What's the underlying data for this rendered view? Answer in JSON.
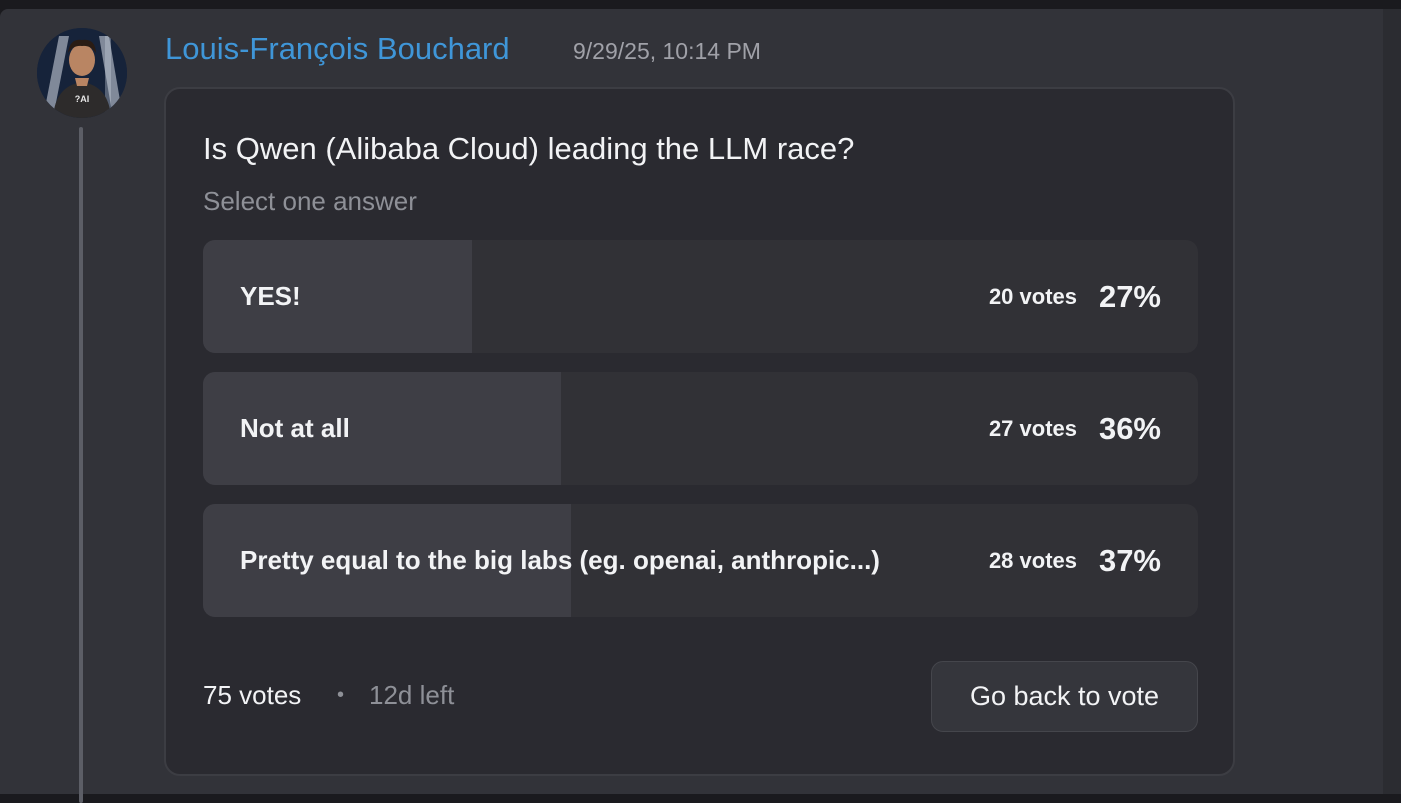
{
  "message": {
    "author": "Louis-François Bouchard",
    "timestamp": "9/29/25, 10:14 PM",
    "avatar_text": "?AI"
  },
  "poll": {
    "question": "Is Qwen (Alibaba Cloud) leading the LLM race?",
    "instruction": "Select one answer",
    "answers": [
      {
        "label": "YES!",
        "votes": "20 votes",
        "percent": "27%",
        "fraction": 0.27
      },
      {
        "label": "Not at all",
        "votes": "27 votes",
        "percent": "36%",
        "fraction": 0.36
      },
      {
        "label": "Pretty equal to the big labs (eg. openai, anthropic...)",
        "votes": "28 votes",
        "percent": "37%",
        "fraction": 0.37
      }
    ],
    "total_votes": "75 votes",
    "separator": "•",
    "time_left": "12d left",
    "vote_button_label": "Go back to vote"
  },
  "colors": {
    "author": "#3f96d8",
    "card_background": "#2a2a30",
    "answer_fill": "#3e3e45"
  }
}
